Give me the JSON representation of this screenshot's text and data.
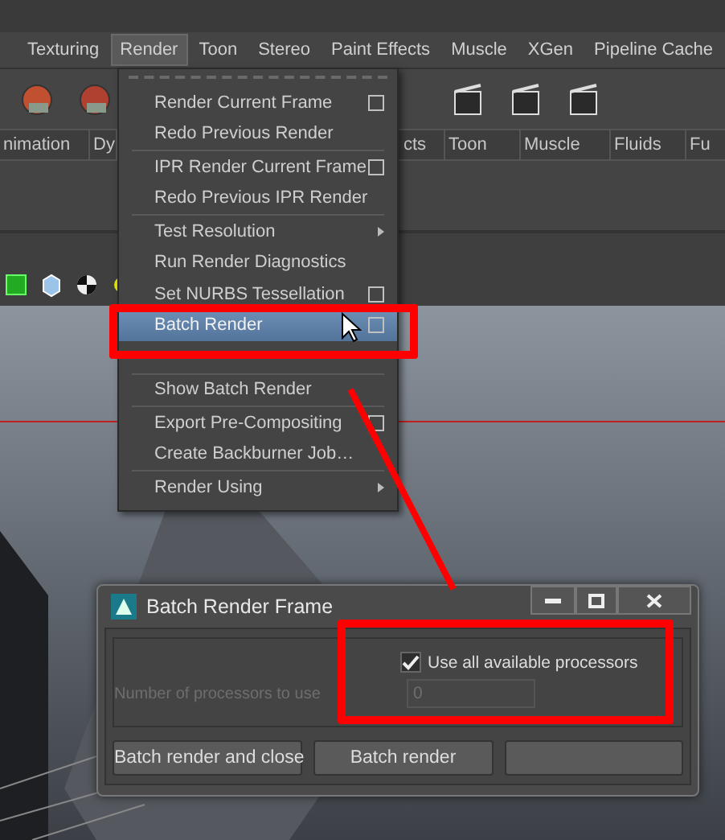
{
  "menu_bar": [
    {
      "label": "Texturing",
      "selected": false
    },
    {
      "label": "Render",
      "selected": true
    },
    {
      "label": "Toon",
      "selected": false
    },
    {
      "label": "Stereo",
      "selected": false
    },
    {
      "label": "Paint Effects",
      "selected": false
    },
    {
      "label": "Muscle",
      "selected": false
    },
    {
      "label": "XGen",
      "selected": false
    },
    {
      "label": "Pipeline Cache",
      "selected": false
    }
  ],
  "shelf_tabs": [
    "nimation",
    "Dy",
    "cts",
    "Toon",
    "Muscle",
    "Fluids",
    "Fu"
  ],
  "render_menu": {
    "items": [
      {
        "kind": "item",
        "label": "Render Current Frame",
        "option_box": true,
        "selected": false
      },
      {
        "kind": "item",
        "label": "Redo Previous Render",
        "option_box": false,
        "selected": false
      },
      {
        "kind": "separator"
      },
      {
        "kind": "item",
        "label": "IPR Render Current Frame",
        "option_box": true,
        "selected": false
      },
      {
        "kind": "item",
        "label": "Redo Previous IPR Render",
        "option_box": false,
        "selected": false
      },
      {
        "kind": "separator"
      },
      {
        "kind": "submenu",
        "label": "Test Resolution",
        "selected": false
      },
      {
        "kind": "item",
        "label": "Run Render Diagnostics",
        "option_box": false,
        "selected": false
      },
      {
        "kind": "item",
        "label": "Set NURBS Tessellation",
        "option_box": true,
        "selected": false
      },
      {
        "kind": "item",
        "label": "Batch Render",
        "option_box": true,
        "selected": true
      },
      {
        "kind": "covered"
      },
      {
        "kind": "separator"
      },
      {
        "kind": "item",
        "label": "Show Batch Render",
        "option_box": false,
        "selected": false
      },
      {
        "kind": "separator"
      },
      {
        "kind": "item",
        "label": "Export Pre-Compositing",
        "option_box": true,
        "selected": false
      },
      {
        "kind": "item",
        "label": "Create Backburner Job…",
        "option_box": false,
        "selected": false
      },
      {
        "kind": "separator"
      },
      {
        "kind": "submenu",
        "label": "Render Using",
        "selected": false
      }
    ]
  },
  "dialog": {
    "title": "Batch Render Frame",
    "use_all_processors": {
      "label": "Use all available processors",
      "checked": true
    },
    "processor_count": {
      "label": "Number of processors to use",
      "value": "0",
      "disabled": true
    },
    "buttons": [
      "Batch render and close",
      "Batch render"
    ]
  }
}
